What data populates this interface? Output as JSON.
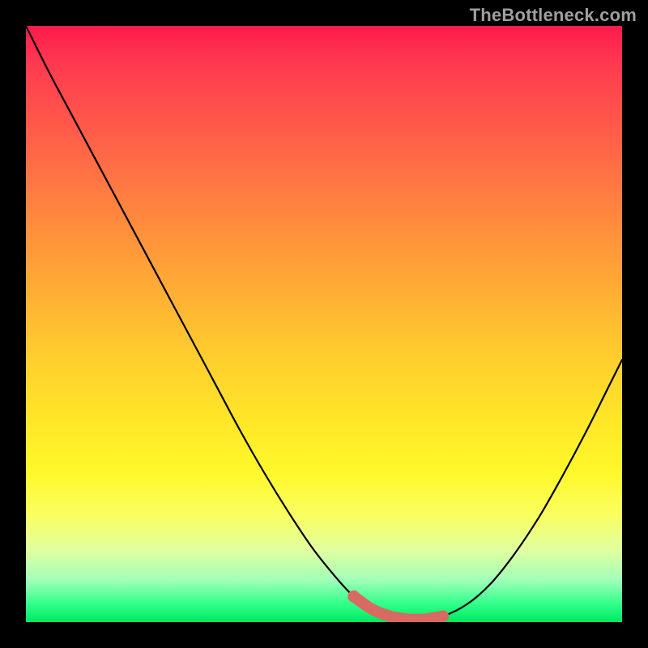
{
  "watermark": "TheBottleneck.com",
  "chart_data": {
    "type": "line",
    "title": "",
    "xlabel": "",
    "ylabel": "",
    "xlim": [
      0,
      100
    ],
    "ylim": [
      0,
      100
    ],
    "grid": false,
    "series": [
      {
        "name": "curve",
        "x": [
          0,
          4,
          8,
          12,
          16,
          20,
          24,
          28,
          32,
          36,
          40,
          44,
          48,
          52,
          55,
          58,
          61,
          64,
          67,
          70,
          74,
          78,
          82,
          86,
          90,
          94,
          98,
          100
        ],
        "y": [
          100,
          92,
          84.5,
          77,
          69.5,
          62,
          54.5,
          47,
          39.5,
          32,
          25,
          18.5,
          12.5,
          7.5,
          4.3,
          2.2,
          1.0,
          0.5,
          0.5,
          1.0,
          3.0,
          6.5,
          11.5,
          17.5,
          24.5,
          32,
          40,
          44
        ]
      },
      {
        "name": "optimal-range",
        "x": [
          55,
          58,
          61,
          64,
          67,
          70
        ],
        "y": [
          4.3,
          2.2,
          1.0,
          0.5,
          0.5,
          1.0
        ]
      }
    ],
    "colors": {
      "curve": "#000000",
      "highlight": "#d86a62",
      "gradient_top": "#ff1a4d",
      "gradient_mid": "#ffe628",
      "gradient_bottom": "#00e860"
    }
  }
}
